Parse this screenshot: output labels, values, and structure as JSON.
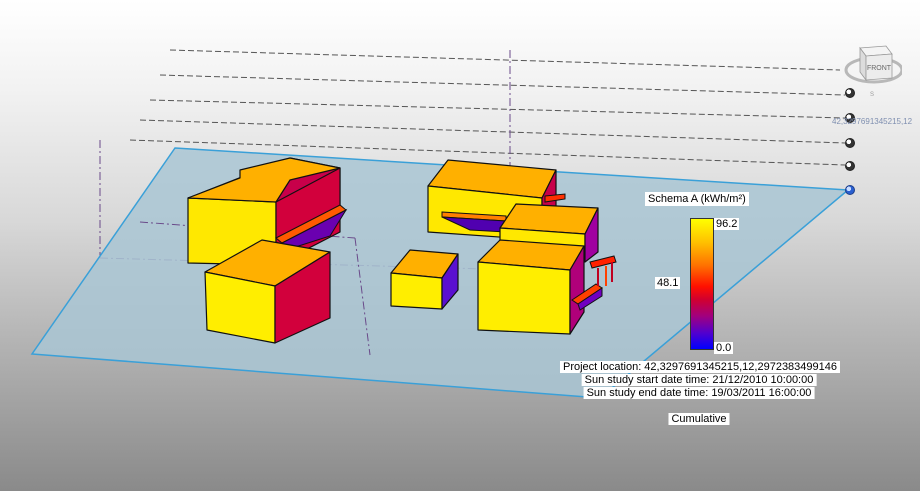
{
  "legend": {
    "title": "Schema A (kWh/m²)",
    "max": "96.2",
    "mid": "48.1",
    "min": "0.0",
    "colors": [
      "#ffff00",
      "#ff7000",
      "#ff1000",
      "#a00080",
      "#0000ff"
    ]
  },
  "info": {
    "project_location": "Project location: 42,3297691345215,12,2972383499146",
    "start": "Sun study start date time: 21/12/2010 10:00:00",
    "end": "Sun study end date time: 19/03/2011 16:00:00",
    "mode": "Cumulative"
  },
  "viewcube": {
    "face_label": "FRONT"
  },
  "coordinate_readout": "42,3297691345215,12",
  "colors": {
    "ground_plane": "#a9c6d4",
    "building_top": "#ffb400",
    "building_front": "#ffe400",
    "building_side": "#c8004a"
  }
}
